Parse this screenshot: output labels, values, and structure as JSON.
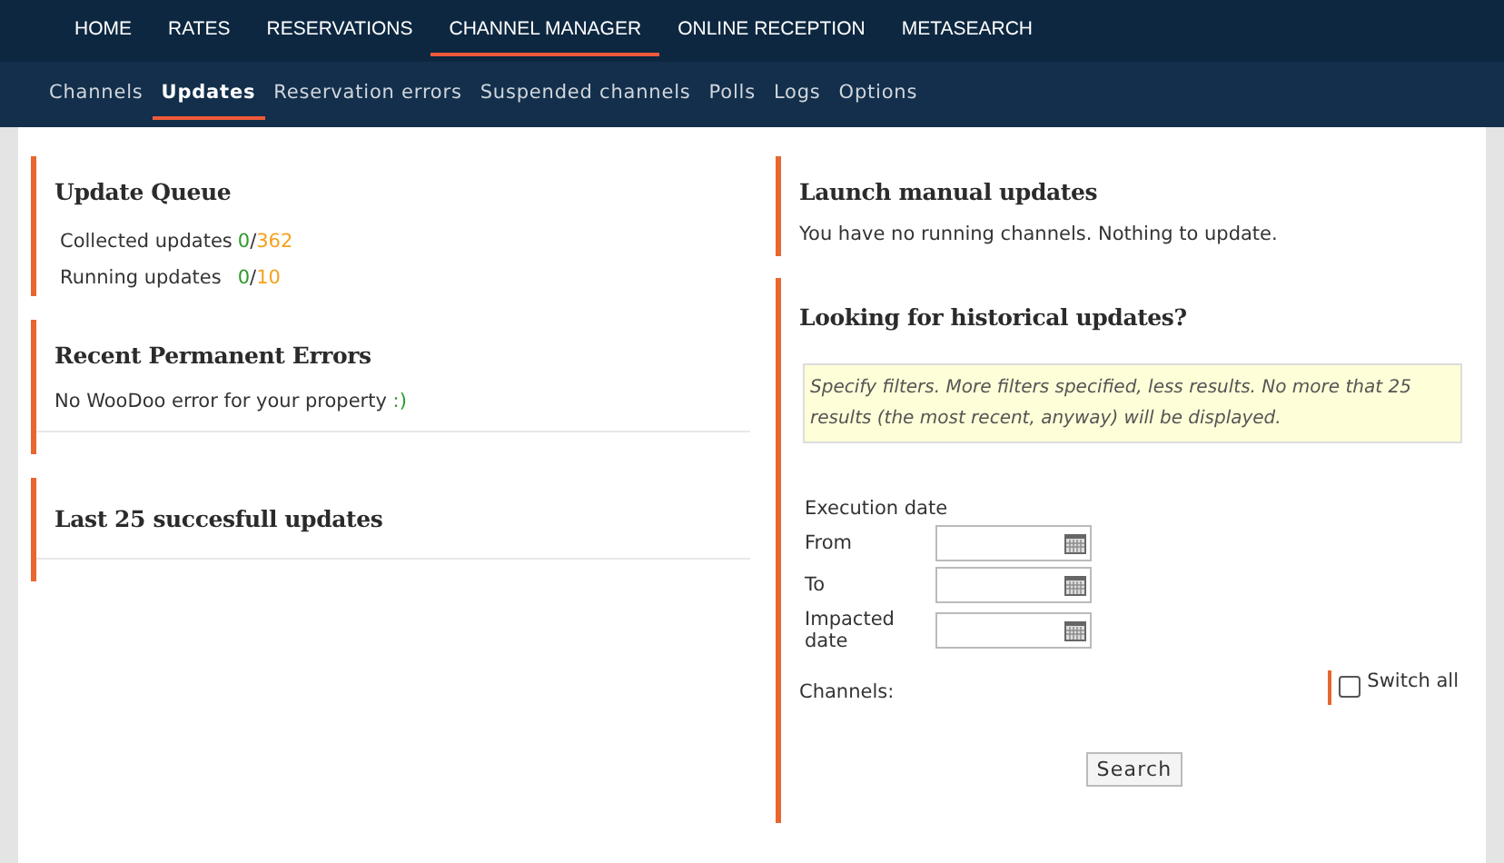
{
  "main_nav": [
    {
      "label": "HOME",
      "selected": false
    },
    {
      "label": "RATES",
      "selected": false
    },
    {
      "label": "RESERVATIONS",
      "selected": false
    },
    {
      "label": "CHANNEL MANAGER",
      "selected": true
    },
    {
      "label": "ONLINE RECEPTION",
      "selected": false
    },
    {
      "label": "METASEARCH",
      "selected": false
    }
  ],
  "sub_nav": [
    {
      "label": "Channels",
      "selected": false
    },
    {
      "label": "Updates",
      "selected": true
    },
    {
      "label": "Reservation errors",
      "selected": false
    },
    {
      "label": "Suspended channels",
      "selected": false
    },
    {
      "label": "Polls",
      "selected": false
    },
    {
      "label": "Logs",
      "selected": false
    },
    {
      "label": "Options",
      "selected": false
    }
  ],
  "update_queue": {
    "title": "Update Queue",
    "rows": [
      {
        "label": "Collected updates",
        "done": "0",
        "separator": "/",
        "total": "362"
      },
      {
        "label": "Running updates",
        "done": "0",
        "separator": "/",
        "total": "10"
      }
    ]
  },
  "recent_errors": {
    "title": "Recent Permanent Errors",
    "message": "No WooDoo error for your property",
    "emoticon": ":)"
  },
  "last_updates": {
    "title": "Last 25 succesfull updates"
  },
  "manual_updates": {
    "title": "Launch manual updates",
    "message": "You have no running channels. Nothing to update."
  },
  "historical": {
    "title": "Looking for historical updates?",
    "notice": "Specify filters. More filters specified, less results. No more that 25 results (the most recent, anyway) will be displayed.",
    "group_label": "Execution date",
    "fields": [
      {
        "label": "From"
      },
      {
        "label": "To"
      },
      {
        "label": "Impacted date"
      }
    ],
    "channels_label": "Channels:",
    "switch_all": {
      "label": "Switch all",
      "checked": false
    },
    "search_button": "Search"
  }
}
